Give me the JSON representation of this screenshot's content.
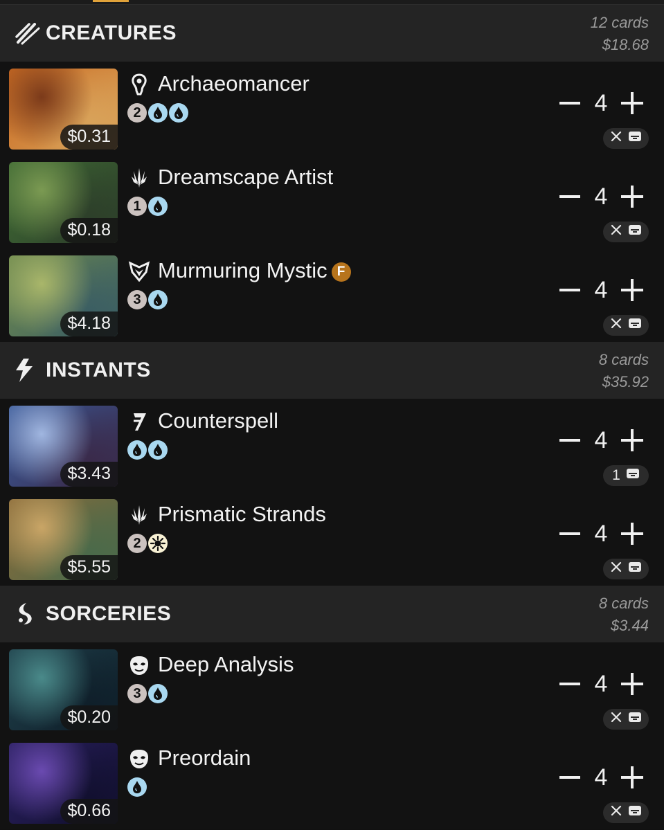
{
  "sections": [
    {
      "key": "creatures",
      "title": "CREATURES",
      "icon": "claw-marks-icon",
      "count_text": "12 cards",
      "total_text": "$18.68",
      "cards": [
        {
          "name": "Archaeomancer",
          "type_icon": "creature-icon",
          "price": "$0.31",
          "mana": [
            "2",
            "U",
            "U"
          ],
          "qty": "4",
          "foil": "",
          "pill": {
            "kind": "x",
            "text": ""
          },
          "art": [
            "#c96a22",
            "#7b3a1a",
            "#d9a35a"
          ]
        },
        {
          "name": "Dreamscape Artist",
          "type_icon": "planeswalker-icon",
          "price": "$0.18",
          "mana": [
            "1",
            "U"
          ],
          "qty": "4",
          "foil": "",
          "pill": {
            "kind": "x",
            "text": ""
          },
          "art": [
            "#3f6b34",
            "#7b9a52",
            "#2d3f2a"
          ]
        },
        {
          "name": "Murmuring Mystic",
          "type_icon": "mystic-icon",
          "price": "$4.18",
          "mana": [
            "3",
            "U"
          ],
          "qty": "4",
          "foil": "F",
          "pill": {
            "kind": "x",
            "text": ""
          },
          "art": [
            "#6f8a4e",
            "#a9b66a",
            "#3b5e63"
          ]
        }
      ]
    },
    {
      "key": "instants",
      "title": "INSTANTS",
      "icon": "lightning-icon",
      "count_text": "8 cards",
      "total_text": "$35.92",
      "cards": [
        {
          "name": "Counterspell",
          "type_icon": "counterspell-icon",
          "price": "$3.43",
          "mana": [
            "U",
            "U"
          ],
          "qty": "4",
          "foil": "",
          "pill": {
            "kind": "count",
            "text": "1"
          },
          "art": [
            "#3a5a98",
            "#a0b6e0",
            "#3a2a4a"
          ]
        },
        {
          "name": "Prismatic Strands",
          "type_icon": "planeswalker-icon",
          "price": "$5.55",
          "mana": [
            "2",
            "W"
          ],
          "qty": "4",
          "foil": "",
          "pill": {
            "kind": "x",
            "text": ""
          },
          "art": [
            "#8a6b3a",
            "#c9a566",
            "#4a6a4a"
          ]
        }
      ]
    },
    {
      "key": "sorceries",
      "title": "SORCERIES",
      "icon": "swirl-icon",
      "count_text": "8 cards",
      "total_text": "$3.44",
      "cards": [
        {
          "name": "Deep Analysis",
          "type_icon": "mask-icon",
          "price": "$0.20",
          "mana": [
            "3",
            "U"
          ],
          "qty": "4",
          "foil": "",
          "pill": {
            "kind": "x",
            "text": ""
          },
          "art": [
            "#1f3f4a",
            "#4a8a8a",
            "#0f1f2a"
          ]
        },
        {
          "name": "Preordain",
          "type_icon": "mask-icon",
          "price": "$0.66",
          "mana": [
            "U"
          ],
          "qty": "4",
          "foil": "",
          "pill": {
            "kind": "x",
            "text": ""
          },
          "art": [
            "#2a2060",
            "#6a4ab0",
            "#121030"
          ]
        }
      ]
    }
  ]
}
